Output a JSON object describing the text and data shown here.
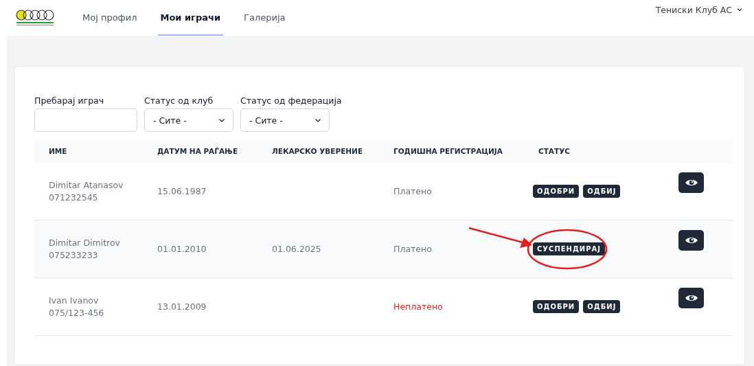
{
  "nav": {
    "tabs": [
      {
        "label": "Мој профил",
        "selected": false
      },
      {
        "label": "Мои играчи",
        "selected": true
      },
      {
        "label": "Галерија",
        "selected": false
      }
    ],
    "account": "Тениски Клуб АС"
  },
  "filters": [
    {
      "kind": "text",
      "label": "Пребарај играч"
    },
    {
      "kind": "select",
      "label": "Статус од клуб",
      "value": "- Сите -"
    },
    {
      "kind": "select",
      "label": "Статус од федерација",
      "value": "- Сите -"
    }
  ],
  "table": {
    "columns": [
      "ИМЕ",
      "ДАТУМ НА РАЃАЊЕ",
      "ЛЕКАРСКО УВЕРЕНИЕ",
      "ГОДИШНА РЕГИСТРАЦИЈА",
      "СТАТУС"
    ],
    "rows": [
      {
        "name": "Dimitar Atanasov",
        "phone": "071232545",
        "birth": "15.06.1987",
        "registration": "Платено",
        "paid": true,
        "status_buttons": [
          "ОДОБРИ",
          "ОДБИЈ"
        ]
      },
      {
        "name": "Dimitar Dimitrov",
        "phone": "075233233",
        "birth": "01.01.2010",
        "medical": "01.06.2025",
        "registration": "Платено",
        "paid": true,
        "status_buttons": [
          "СУСПЕНДИРАЈ"
        ],
        "annotated": true
      },
      {
        "name": "Ivan Ivanov",
        "phone": "075/123-456",
        "birth": "13.01.2009",
        "registration": "Неплатено",
        "paid": false,
        "status_buttons": [
          "ОДОБРИ",
          "ОДБИЈ"
        ]
      }
    ]
  }
}
